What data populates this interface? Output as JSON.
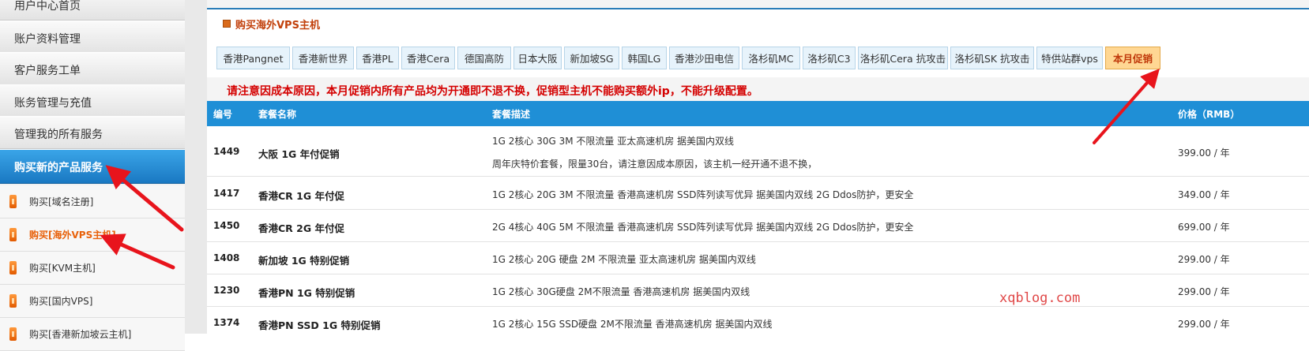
{
  "sidebar": {
    "items": [
      {
        "label": "用户中心首页"
      },
      {
        "label": "账户资料管理"
      },
      {
        "label": "客户服务工单"
      },
      {
        "label": "账务管理与充值"
      },
      {
        "label": "管理我的所有服务"
      },
      {
        "label": "购买新的产品服务"
      }
    ],
    "sub_items": [
      {
        "label": "购买[域名注册]"
      },
      {
        "label": "购买[海外VPS主机]"
      },
      {
        "label": "购买[KVM主机]"
      },
      {
        "label": "购买[国内VPS]"
      },
      {
        "label": "购买[香港新加坡云主机]"
      }
    ]
  },
  "panel": {
    "title": "购买海外VPS主机"
  },
  "tabs": [
    {
      "label": "香港Pangnet"
    },
    {
      "label": "香港新世界"
    },
    {
      "label": "香港PL"
    },
    {
      "label": "香港Cera"
    },
    {
      "label": "德国高防"
    },
    {
      "label": "日本大阪"
    },
    {
      "label": "新加坡SG"
    },
    {
      "label": "韩国LG"
    },
    {
      "label": "香港沙田电信"
    },
    {
      "label": "洛杉矶MC"
    },
    {
      "label": "洛杉矶C3"
    },
    {
      "label": "洛杉矶Cera 抗攻击"
    },
    {
      "label": "洛杉矶SK 抗攻击"
    },
    {
      "label": "特供站群vps"
    },
    {
      "label": "本月促销"
    }
  ],
  "notice": "请注意因成本原因，本月促销内所有产品均为开通即不退不换，促销型主机不能购买额外ip，不能升级配置。",
  "table": {
    "headers": {
      "id": "编号",
      "name": "套餐名称",
      "desc": "套餐描述",
      "price": "价格（RMB）"
    },
    "rows": [
      {
        "id": "1449",
        "name": "大阪 1G 年付促销",
        "desc": "1G 2核心 30G 3M 不限流量 亚太高速机房 据美国内双线",
        "desc2": "周年庆特价套餐，限量30台，请注意因成本原因，该主机一经开通不退不换，",
        "price": "399.00 / 年"
      },
      {
        "id": "1417",
        "name": "香港CR 1G 年付促",
        "desc": "1G 2核心 20G 3M 不限流量 香港高速机房 SSD阵列读写优异 据美国内双线 2G Ddos防护，更安全",
        "price": "349.00 / 年"
      },
      {
        "id": "1450",
        "name": "香港CR 2G 年付促",
        "desc": "2G 4核心 40G 5M 不限流量 香港高速机房 SSD阵列读写优异 据美国内双线 2G Ddos防护，更安全",
        "price": "699.00 / 年"
      },
      {
        "id": "1408",
        "name": "新加坡 1G 特别促销",
        "desc": "1G 2核心 20G 硬盘 2M 不限流量 亚太高速机房 据美国内双线",
        "price": "299.00 / 年"
      },
      {
        "id": "1230",
        "name": "香港PN 1G 特别促销",
        "desc": "1G 2核心 30G硬盘 2M不限流量 香港高速机房 据美国内双线",
        "price": "299.00 / 年"
      },
      {
        "id": "1374",
        "name": "香港PN SSD 1G 特别促销",
        "desc": "1G 2核心 15G SSD硬盘 2M不限流量 香港高速机房 据美国内双线",
        "price": "299.00 / 年"
      }
    ]
  },
  "watermark": "xqblog.com",
  "colors": {
    "accent_blue": "#1f8fd6",
    "active_tab": "#ffd793",
    "notice_red": "#d40000",
    "annotation_red": "#e8141c"
  }
}
